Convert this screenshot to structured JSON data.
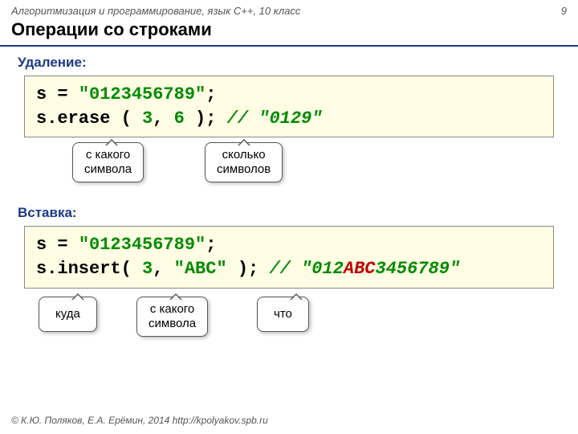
{
  "header": {
    "course": "Алгоритмизация и программирование, язык C++, 10 класс",
    "page_number": "9"
  },
  "title": "Операции со строками",
  "section1": {
    "heading": "Удаление:",
    "code_line1_a": "s = ",
    "code_line1_b": "\"0123456789\"",
    "code_line1_c": ";",
    "code_line2_a": "s.erase ( ",
    "code_line2_b": "3",
    "code_line2_c": ", ",
    "code_line2_d": "6",
    "code_line2_e": " ); ",
    "code_line2_f": "// \"0129\"",
    "callout1": "с какого\nсимвола",
    "callout2": "сколько\nсимволов"
  },
  "section2": {
    "heading": "Вставка:",
    "code_line1_a": "s = ",
    "code_line1_b": "\"0123456789\"",
    "code_line1_c": ";",
    "code_line2_a": "s.insert( ",
    "code_line2_b": "3",
    "code_line2_c": ", ",
    "code_line2_d": "\"ABC\"",
    "code_line2_e": " ); ",
    "code_line2_f": "// \"012",
    "code_line2_g": "ABC",
    "code_line2_h": "3456789\"",
    "callout1": "куда",
    "callout2": "с какого\nсимвола",
    "callout3": "что"
  },
  "footer": "© К.Ю. Поляков, Е.А. Ерёмин, 2014   http://kpolyakov.spb.ru"
}
